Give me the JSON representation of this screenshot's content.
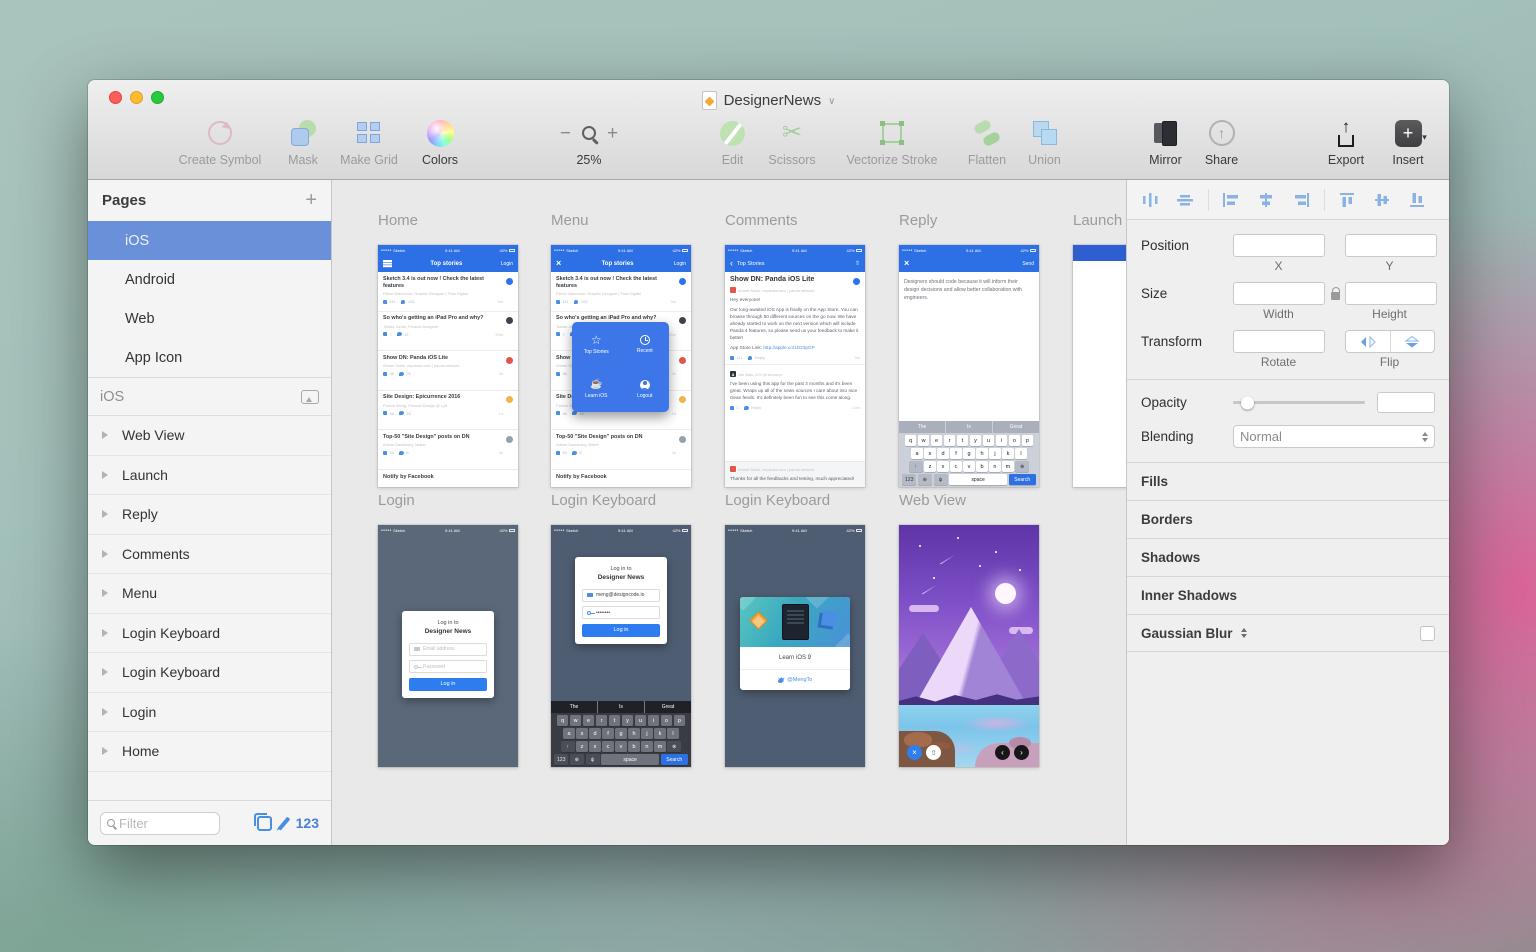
{
  "window": {
    "title": "DesignerNews"
  },
  "toolbar": {
    "create_symbol": "Create Symbol",
    "mask": "Mask",
    "make_grid": "Make Grid",
    "colors": "Colors",
    "zoom_value": "25%",
    "edit": "Edit",
    "scissors": "Scissors",
    "vectorize_stroke": "Vectorize Stroke",
    "flatten": "Flatten",
    "union": "Union",
    "mirror": "Mirror",
    "share": "Share",
    "export": "Export",
    "insert": "Insert"
  },
  "sidebar": {
    "pages_header": "Pages",
    "pages": [
      {
        "label": "iOS"
      },
      {
        "label": "Android"
      },
      {
        "label": "Web"
      },
      {
        "label": "App Icon"
      }
    ],
    "section_header": "iOS",
    "layers": [
      "Web View",
      "Launch",
      "Reply",
      "Comments",
      "Menu",
      "Login Keyboard",
      "Login Keyboard",
      "Login",
      "Home"
    ],
    "filter_placeholder": "Filter",
    "layer_count": "123"
  },
  "status_bar": {
    "carrier": "Sketch",
    "time": "9:41 AM",
    "battery": "42%"
  },
  "stories": [
    {
      "title": "Sketch 3.4 is out now ! Check the latest features",
      "meta": "Pierre Dalencour, Graphic Designer | Flow Digital",
      "votes": "111",
      "comments_count": "103",
      "time": "9m",
      "badge": "#2d72f0"
    },
    {
      "title": "So who's getting an iPad Pro and why?",
      "meta": "Tobias Jonah, Product Designer",
      "votes": "7",
      "comments_count": "12",
      "time": "20m",
      "badge": "#3c434e"
    },
    {
      "title": "Show DN: Panda iOS Lite",
      "meta": "Ahmet Sulek, nepanda.com | panda.network",
      "votes": "38",
      "comments_count": "29",
      "time": "4h",
      "badge": "#e2574c"
    },
    {
      "title": "Site Design: Epicurrence 2016",
      "meta": "Patrick Wong, Product Design @ Lyft",
      "votes": "46",
      "comments_count": "16",
      "time": "1d",
      "badge": "#f0b44c"
    },
    {
      "title": "Top-50 \"Site Design\" posts on DN",
      "meta": "Artiom Dashinsky, Maker",
      "votes": "53",
      "comments_count": "8",
      "time": "3d",
      "badge": "#97a1ab"
    }
  ],
  "stories_footer": "Notify by Facebook",
  "artboards": {
    "home": {
      "title": "Home",
      "nav_title": "Top stories",
      "nav_action": "Login"
    },
    "menu": {
      "title": "Menu",
      "nav_title": "Top stories",
      "nav_action": "Login",
      "overlay": {
        "item1": "Top Stories",
        "item2": "Recent",
        "item3": "Learn iOS",
        "item4": "Logout"
      }
    },
    "comments": {
      "title": "Comments",
      "nav_back": "Top Stories",
      "story_title": "Show DN: Panda iOS Lite",
      "story_meta": "Ahmet Sulek, nepanda.com | panda.network",
      "greeting": "Hey everyone!",
      "body": "Our long-awaited iOS App is finally on the App Store. You can browse through 50 different sources on the go now. We have already started to work on the next version which will include Panda 4 features, so please send us your feedback to make it better!",
      "link_label": "App Store Link:",
      "link_url": "http://apple.co/1D23pGP",
      "upvotes": "111",
      "reply_label": "Reply",
      "time": "9m",
      "comment_author_meta": "Joe Blau, iOS @ Amazon",
      "comment_avatar": "a",
      "comment_body": "I've been using this app for the past 3 months and it's been great. Wraps up all of the news sources I care about into nice clean feeds. It's definitely been fun to see this come along.",
      "comment_upvotes": "1",
      "comment_time": "20m",
      "reply_author_meta": "Ahmet Sulek, nepanda.com | panda.network",
      "reply_body": "Thanks for all the feedbacks and testing, much appreciated!"
    },
    "reply": {
      "title": "Reply",
      "send_label": "Send",
      "draft": "Designers should code because it will inform their design decisions and allow better collaboration with engineers."
    },
    "launch": {
      "title": "Launch"
    },
    "login": {
      "title": "Login"
    },
    "login_keyboard_1": {
      "title": "Login Keyboard",
      "email_value": "meng@designcode.io",
      "password_value": "••••••••"
    },
    "login_keyboard_2": {
      "title": "Login Keyboard",
      "card_title": "Learn iOS 9",
      "twitter_handle": "@MengTo"
    },
    "web_view": {
      "title": "Web View"
    }
  },
  "login_card": {
    "heading_line1": "Log in to",
    "heading_line2": "Designer News",
    "email_placeholder": "Email address",
    "password_placeholder": "Password",
    "button": "Log in"
  },
  "keyboard": {
    "suggestions": [
      "The",
      "Is",
      "Great"
    ],
    "row1": [
      "q",
      "w",
      "e",
      "r",
      "t",
      "y",
      "u",
      "i",
      "o",
      "p"
    ],
    "row2": [
      "a",
      "s",
      "d",
      "f",
      "g",
      "h",
      "j",
      "k",
      "l"
    ],
    "row3": [
      "z",
      "x",
      "c",
      "v",
      "b",
      "n",
      "m"
    ],
    "key_shift": "↑",
    "key_backspace": "⊗",
    "key_123": "123",
    "key_globe": "⊕",
    "key_mic": "ψ",
    "key_space": "space",
    "key_search": "Search"
  },
  "inspector": {
    "position_label": "Position",
    "x_label": "X",
    "y_label": "Y",
    "size_label": "Size",
    "width_label": "Width",
    "height_label": "Height",
    "transform_label": "Transform",
    "rotate_label": "Rotate",
    "flip_label": "Flip",
    "opacity_label": "Opacity",
    "blending_label": "Blending",
    "blending_value": "Normal",
    "style_sections": [
      "Fills",
      "Borders",
      "Shadows",
      "Inner Shadows"
    ],
    "gaussian_blur_label": "Gaussian Blur"
  },
  "colors": {
    "accent_blue": "#2d6fe4",
    "selection_blue": "#6b90da",
    "canvas_gray": "#e9e9e9"
  }
}
